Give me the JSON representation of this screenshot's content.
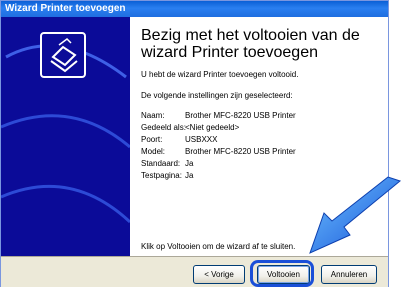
{
  "window": {
    "title": "Wizard Printer toevoegen"
  },
  "side_panel": {
    "icon": "printer-wizard-icon"
  },
  "content": {
    "heading": "Bezig met het voltooien van de wizard Printer toevoegen",
    "intro": "U hebt de wizard Printer toevoegen voltooid.",
    "settings_intro": "De volgende instellingen zijn geselecteerd:",
    "settings": [
      {
        "label": "Naam:",
        "value": "Brother MFC-8220 USB Printer"
      },
      {
        "label": "Gedeeld als:",
        "value": "<Niet gedeeld>"
      },
      {
        "label": "Poort:",
        "value": "USBXXX"
      },
      {
        "label": "Model:",
        "value": "Brother MFC-8220 USB Printer"
      },
      {
        "label": "Standaard:",
        "value": "Ja"
      },
      {
        "label": "Testpagina:",
        "value": "Ja"
      }
    ],
    "footer_text": "Klik op Voltooien om de wizard af te sluiten."
  },
  "buttons": {
    "back": "< Vorige",
    "finish": "Voltooien",
    "cancel": "Annuleren"
  },
  "colors": {
    "titlebar": "#0a5fd6",
    "side_panel": "#0b0b98",
    "highlight": "#1a4fd8",
    "arrow": "#1a7fe0"
  }
}
